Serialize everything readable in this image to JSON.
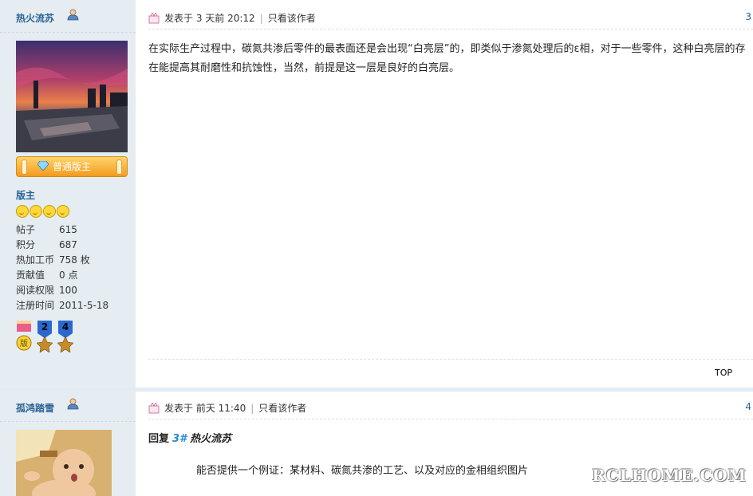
{
  "posts": [
    {
      "author": {
        "name": "热火流苏"
      },
      "badge_label": "普通版主",
      "role": "版主",
      "stats": [
        {
          "label": "帖子",
          "value": "615"
        },
        {
          "label": "积分",
          "value": "687"
        },
        {
          "label": "热加工币",
          "value": "758 枚"
        },
        {
          "label": "贡献值",
          "value": "0 点"
        },
        {
          "label": "阅读权限",
          "value": "100"
        },
        {
          "label": "注册时间",
          "value": "2011-5-18"
        }
      ],
      "medals": [
        {
          "num": "",
          "char": "版"
        },
        {
          "num": "2",
          "char": ""
        },
        {
          "num": "4",
          "char": ""
        }
      ],
      "posted_prefix": "发表于",
      "posted_time": "3 天前 20:12",
      "only_author": "只看该作者",
      "floor": "3",
      "content": "在实际生产过程中，碳氮共渗后零件的最表面还是会出现“白亮层”的，即类似于渗氮处理后的ε相，对于一些零件，这种白亮层的存在能提高其耐磨性和抗蚀性，当然，前提是这一层是良好的白亮层。",
      "top_label": "TOP"
    },
    {
      "author": {
        "name": "孤鸿踏雪"
      },
      "posted_prefix": "发表于",
      "posted_time": "前天 11:40",
      "only_author": "只看该作者",
      "floor": "4",
      "reply_prefix": "回复",
      "reply_floor": "3#",
      "reply_to": "热火流苏",
      "content": "能否提供一个例证：某材料、碳氮共渗的工艺、以及对应的金相组织图片"
    }
  ],
  "watermark": "RCLHOME.COM",
  "colors": {
    "sidebar": "#e5edf2",
    "link": "#2a6496",
    "badge": "#f29b1d"
  }
}
